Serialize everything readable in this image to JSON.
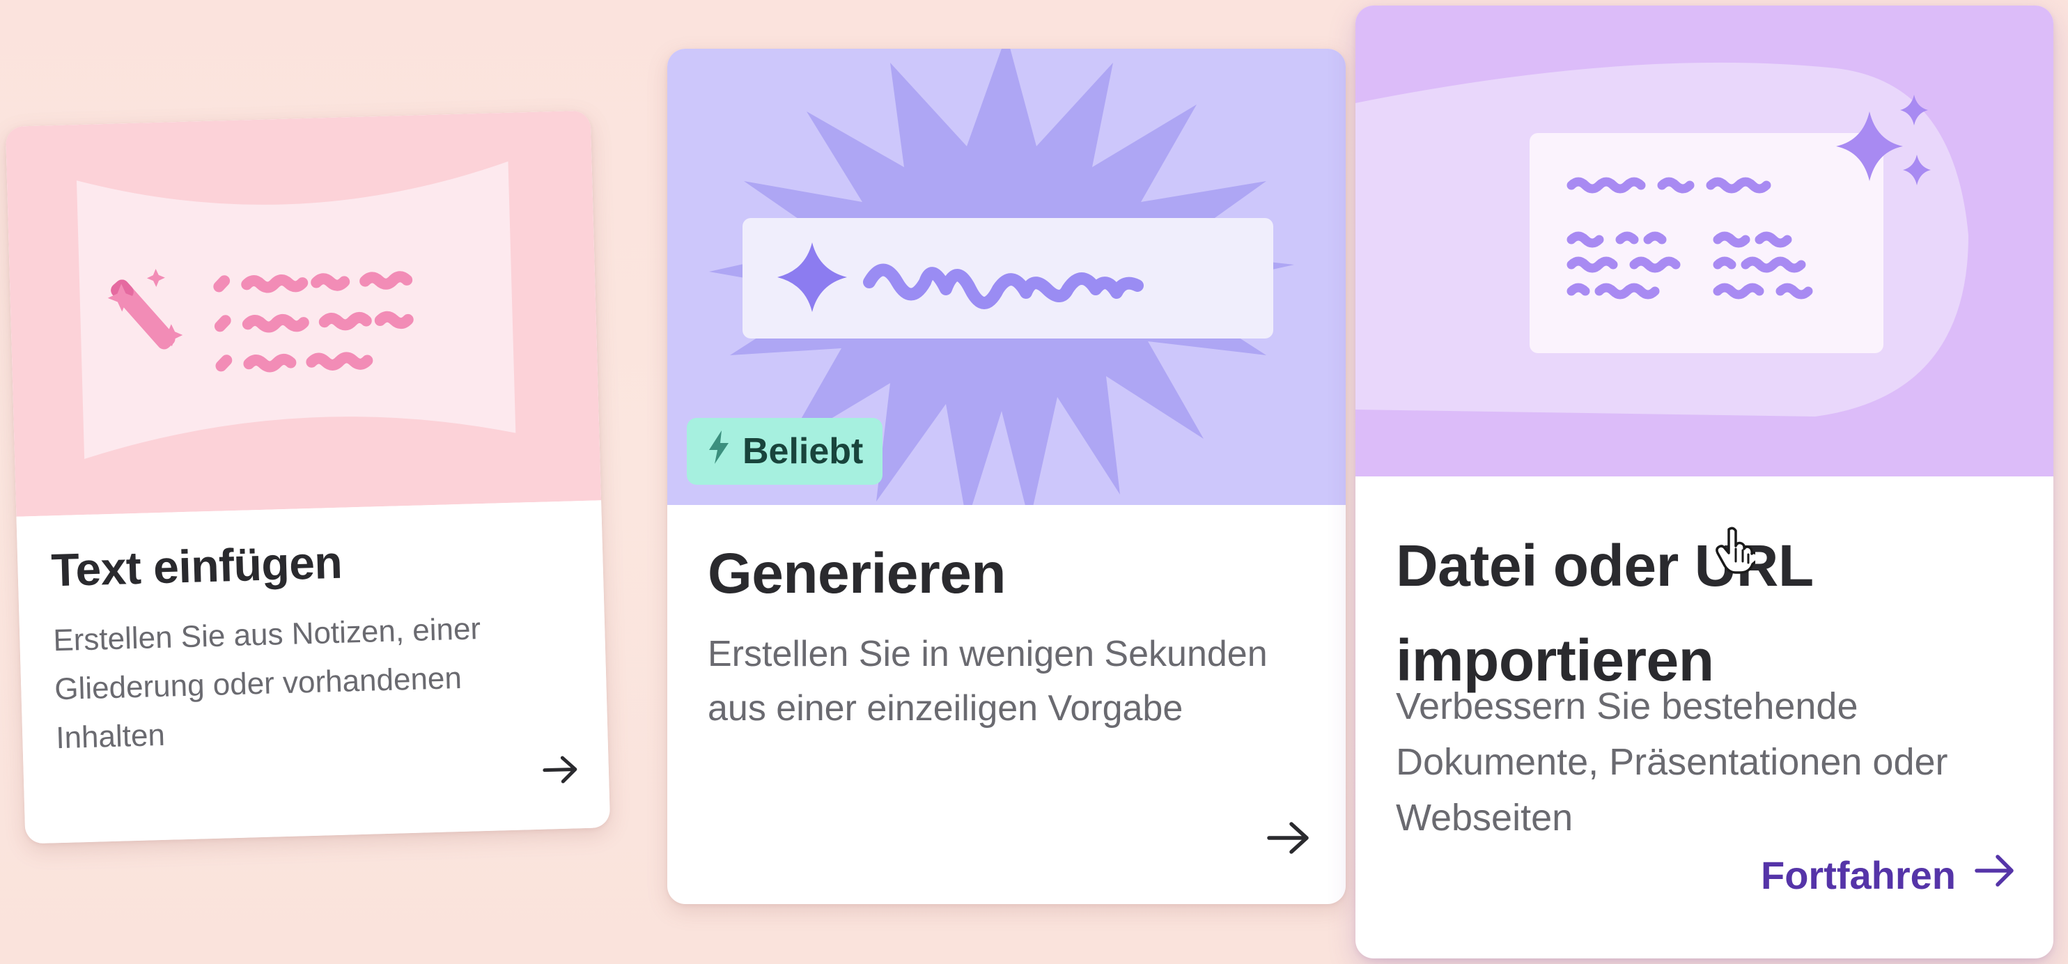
{
  "cards": [
    {
      "title": "Text einfügen",
      "description": "Erstellen Sie aus Notizen, einer Gliederung oder vorhandenen Inhalten",
      "illustration": "magic-wand-text-illustration",
      "arrow_icon": "arrow-right-icon"
    },
    {
      "title": "Generieren",
      "description": "Erstellen Sie in wenigen Sekunden aus einer einzeiligen Vorgabe",
      "badge": "Beliebt",
      "badge_icon": "lightning-icon",
      "illustration": "sparkle-prompt-illustration",
      "arrow_icon": "arrow-right-icon"
    },
    {
      "title": "Datei oder URL importieren",
      "description": "Verbessern Sie bestehende Dokumente, Präsentationen oder Webseiten",
      "action_label": "Fortfahren",
      "illustration": "document-import-illustration",
      "arrow_icon": "arrow-right-icon"
    }
  ],
  "colors": {
    "background": "#fbe3dd",
    "card1_illustration": "#fcd2d8",
    "card2_illustration": "#cdc7fb",
    "card3_illustration": "#dcbcf9",
    "badge_background": "#a6f0df",
    "accent": "#5534a8"
  }
}
